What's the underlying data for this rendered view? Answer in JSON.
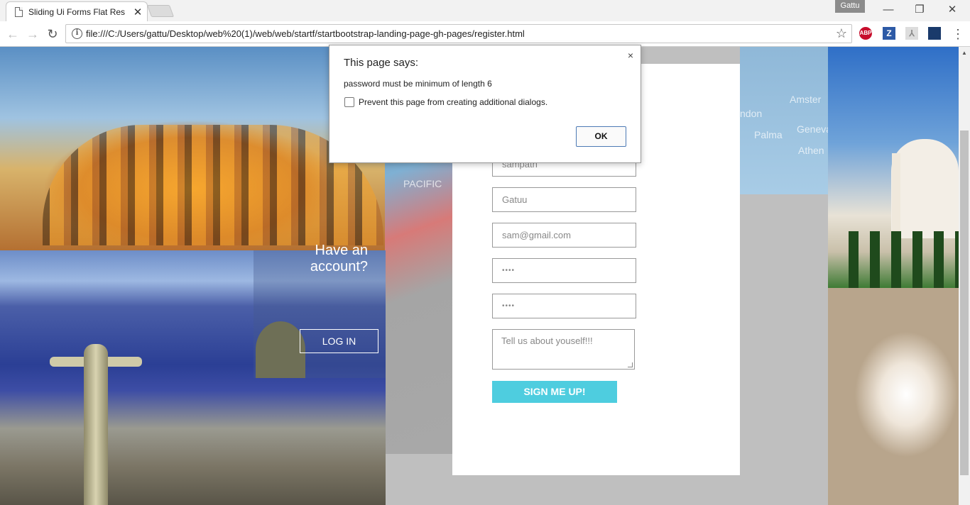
{
  "browser": {
    "tab_title": "Sliding Ui Forms Flat Res",
    "tab_close": "✕",
    "profile_name": "Gattu",
    "url": "file:///C:/Users/gattu/Desktop/web%20(1)/web/web/startf/startbootstrap-landing-page-gh-pages/register.html",
    "icons": [
      "back-arrow-icon",
      "forward-arrow-icon",
      "reload-icon",
      "info-icon",
      "star-icon",
      "menu-icon"
    ],
    "extensions": {
      "abp": "ABP",
      "z": "Z",
      "pdf": "⅄",
      "ph": ""
    },
    "win_minimize": "—",
    "win_restore": "❐",
    "win_close": "✕"
  },
  "page": {
    "account_prompt": "Have an account?",
    "login_label": "LOG IN",
    "map_labels": {
      "pacific": "PACIFIC",
      "amsterdam": "Amster",
      "london": "ndon",
      "palma": "Palma",
      "geneva": "Geneva",
      "athens": "Athen"
    },
    "form": {
      "first_name": "sampath",
      "last_name": "Gatuu",
      "email": "sam@gmail.com",
      "password": "••••",
      "confirm_password": "••••",
      "about_placeholder": "Tell us about youself!!!",
      "submit_label": "SIGN ME UP!"
    }
  },
  "dialog": {
    "title": "This page says:",
    "message": "password must be minimum of length 6",
    "checkbox_label": "Prevent this page from creating additional dialogs.",
    "ok_label": "OK",
    "close_glyph": "×"
  },
  "colors": {
    "accent": "#4ecddf",
    "dialog_ok_border": "#4d7ab5",
    "page_background": "#bdbdbd"
  }
}
